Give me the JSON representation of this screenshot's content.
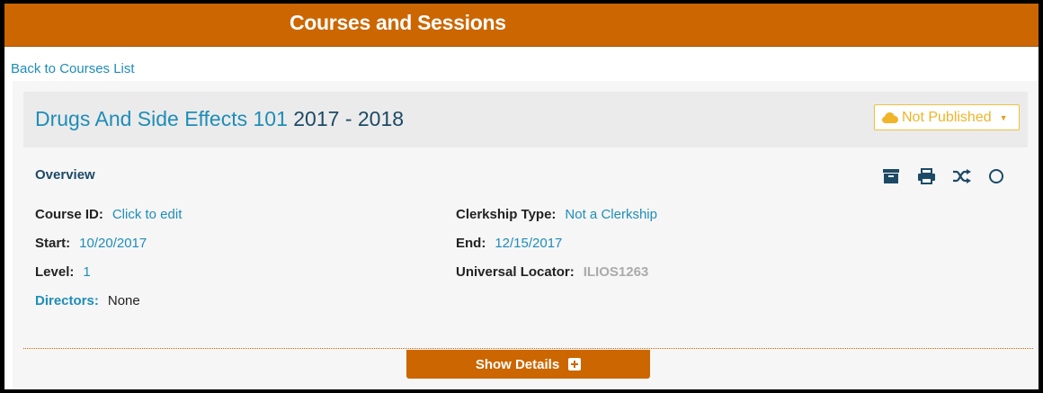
{
  "header": {
    "title": "Courses and Sessions"
  },
  "nav": {
    "back_label": "Back to Courses List"
  },
  "course": {
    "name": "Drugs And Side Effects 101",
    "year": "2017 - 2018",
    "publish_status": "Not Published"
  },
  "overview": {
    "title": "Overview",
    "actions": [
      "archive-icon",
      "print-icon",
      "shuffle-icon",
      "circle-icon"
    ],
    "fields": {
      "course_id": {
        "label": "Course ID:",
        "value": "Click to edit"
      },
      "start": {
        "label": "Start:",
        "value": "10/20/2017"
      },
      "level": {
        "label": "Level:",
        "value": "1"
      },
      "directors": {
        "label": "Directors:",
        "value": "None"
      },
      "clerkship_type": {
        "label": "Clerkship Type:",
        "value": "Not a Clerkship"
      },
      "end": {
        "label": "End:",
        "value": "12/15/2017"
      },
      "universal_locator": {
        "label": "Universal Locator:",
        "value": "ILIOS1263"
      }
    }
  },
  "details": {
    "show_label": "Show Details"
  },
  "colors": {
    "brand": "#cc6600",
    "link": "#1f8db8",
    "dark_text": "#1c4a66",
    "warning": "#f0b429"
  }
}
